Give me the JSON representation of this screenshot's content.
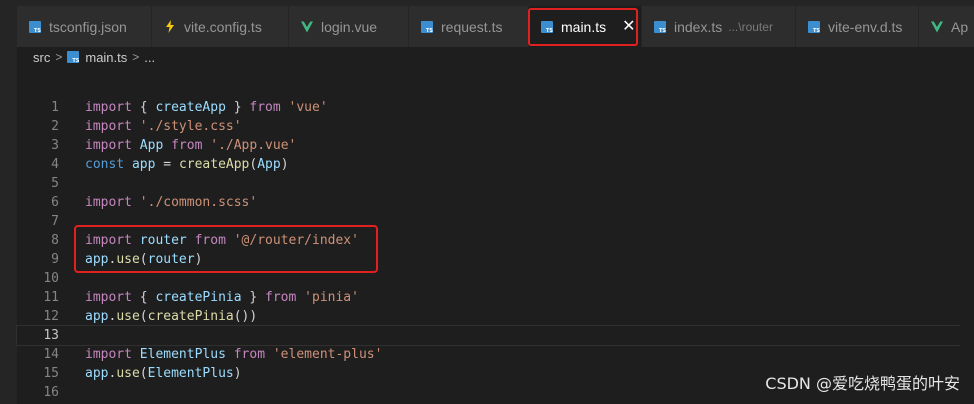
{
  "tabs": [
    {
      "label": "tsconfig.json",
      "icon": "ts-file-icon",
      "active": false
    },
    {
      "label": "vite.config.ts",
      "icon": "bolt-icon",
      "active": false
    },
    {
      "label": "login.vue",
      "icon": "vue-icon",
      "active": false
    },
    {
      "label": "request.ts",
      "icon": "ts-file-icon",
      "active": false
    },
    {
      "label": "main.ts",
      "icon": "ts-file-icon",
      "active": true,
      "close": "✕"
    },
    {
      "label": "index.ts",
      "description": "...\\router",
      "icon": "ts-file-icon",
      "active": false
    },
    {
      "label": "vite-env.d.ts",
      "icon": "ts-file-icon",
      "active": false
    },
    {
      "label": "Ap",
      "icon": "vue-icon",
      "active": false
    }
  ],
  "breadcrumb": {
    "folder": "src",
    "file": "main.ts",
    "ellipsis": "..."
  },
  "code": {
    "lines": [
      {
        "n": "1",
        "tokens": [
          [
            "kw",
            "import"
          ],
          [
            "p",
            " { "
          ],
          [
            "var",
            "createApp"
          ],
          [
            "p",
            " } "
          ],
          [
            "kw",
            "from"
          ],
          [
            "p",
            " "
          ],
          [
            "str",
            "'vue'"
          ]
        ]
      },
      {
        "n": "2",
        "tokens": [
          [
            "kw",
            "import"
          ],
          [
            "p",
            " "
          ],
          [
            "str",
            "'./style.css'"
          ]
        ]
      },
      {
        "n": "3",
        "tokens": [
          [
            "kw",
            "import"
          ],
          [
            "p",
            " "
          ],
          [
            "var",
            "App"
          ],
          [
            "p",
            " "
          ],
          [
            "kw",
            "from"
          ],
          [
            "p",
            " "
          ],
          [
            "str",
            "'./App.vue'"
          ]
        ]
      },
      {
        "n": "4",
        "tokens": [
          [
            "kw2",
            "const"
          ],
          [
            "p",
            " "
          ],
          [
            "var",
            "app"
          ],
          [
            "p",
            " = "
          ],
          [
            "fn",
            "createApp"
          ],
          [
            "p",
            "("
          ],
          [
            "var",
            "App"
          ],
          [
            "p",
            ")"
          ]
        ]
      },
      {
        "n": "5",
        "tokens": []
      },
      {
        "n": "6",
        "tokens": [
          [
            "kw",
            "import"
          ],
          [
            "p",
            " "
          ],
          [
            "str",
            "'./common.scss'"
          ]
        ]
      },
      {
        "n": "7",
        "tokens": []
      },
      {
        "n": "8",
        "tokens": [
          [
            "kw",
            "import"
          ],
          [
            "p",
            " "
          ],
          [
            "var",
            "router"
          ],
          [
            "p",
            " "
          ],
          [
            "kw",
            "from"
          ],
          [
            "p",
            " "
          ],
          [
            "str",
            "'@/router/index'"
          ]
        ]
      },
      {
        "n": "9",
        "tokens": [
          [
            "var",
            "app"
          ],
          [
            "p",
            "."
          ],
          [
            "fn",
            "use"
          ],
          [
            "p",
            "("
          ],
          [
            "var",
            "router"
          ],
          [
            "p",
            ")"
          ]
        ]
      },
      {
        "n": "10",
        "tokens": []
      },
      {
        "n": "11",
        "tokens": [
          [
            "kw",
            "import"
          ],
          [
            "p",
            " { "
          ],
          [
            "var",
            "createPinia"
          ],
          [
            "p",
            " } "
          ],
          [
            "kw",
            "from"
          ],
          [
            "p",
            " "
          ],
          [
            "str",
            "'pinia'"
          ]
        ]
      },
      {
        "n": "12",
        "tokens": [
          [
            "var",
            "app"
          ],
          [
            "p",
            "."
          ],
          [
            "fn",
            "use"
          ],
          [
            "p",
            "("
          ],
          [
            "fn",
            "createPinia"
          ],
          [
            "p",
            "())"
          ]
        ]
      },
      {
        "n": "13",
        "tokens": [],
        "current": true
      },
      {
        "n": "14",
        "tokens": [
          [
            "kw",
            "import"
          ],
          [
            "p",
            " "
          ],
          [
            "var",
            "ElementPlus"
          ],
          [
            "p",
            " "
          ],
          [
            "kw",
            "from"
          ],
          [
            "p",
            " "
          ],
          [
            "str",
            "'element-plus'"
          ]
        ]
      },
      {
        "n": "15",
        "tokens": [
          [
            "var",
            "app"
          ],
          [
            "p",
            "."
          ],
          [
            "fn",
            "use"
          ],
          [
            "p",
            "("
          ],
          [
            "var",
            "ElementPlus"
          ],
          [
            "p",
            ")"
          ]
        ]
      },
      {
        "n": "16",
        "tokens": []
      }
    ]
  },
  "watermark": "CSDN @爱吃烧鸭蛋的叶安",
  "colors": {
    "highlight_border": "#e0211f",
    "keyword": "#c586c0",
    "string": "#ce9178",
    "variable": "#9cdcfe",
    "function": "#dcdcaa"
  }
}
